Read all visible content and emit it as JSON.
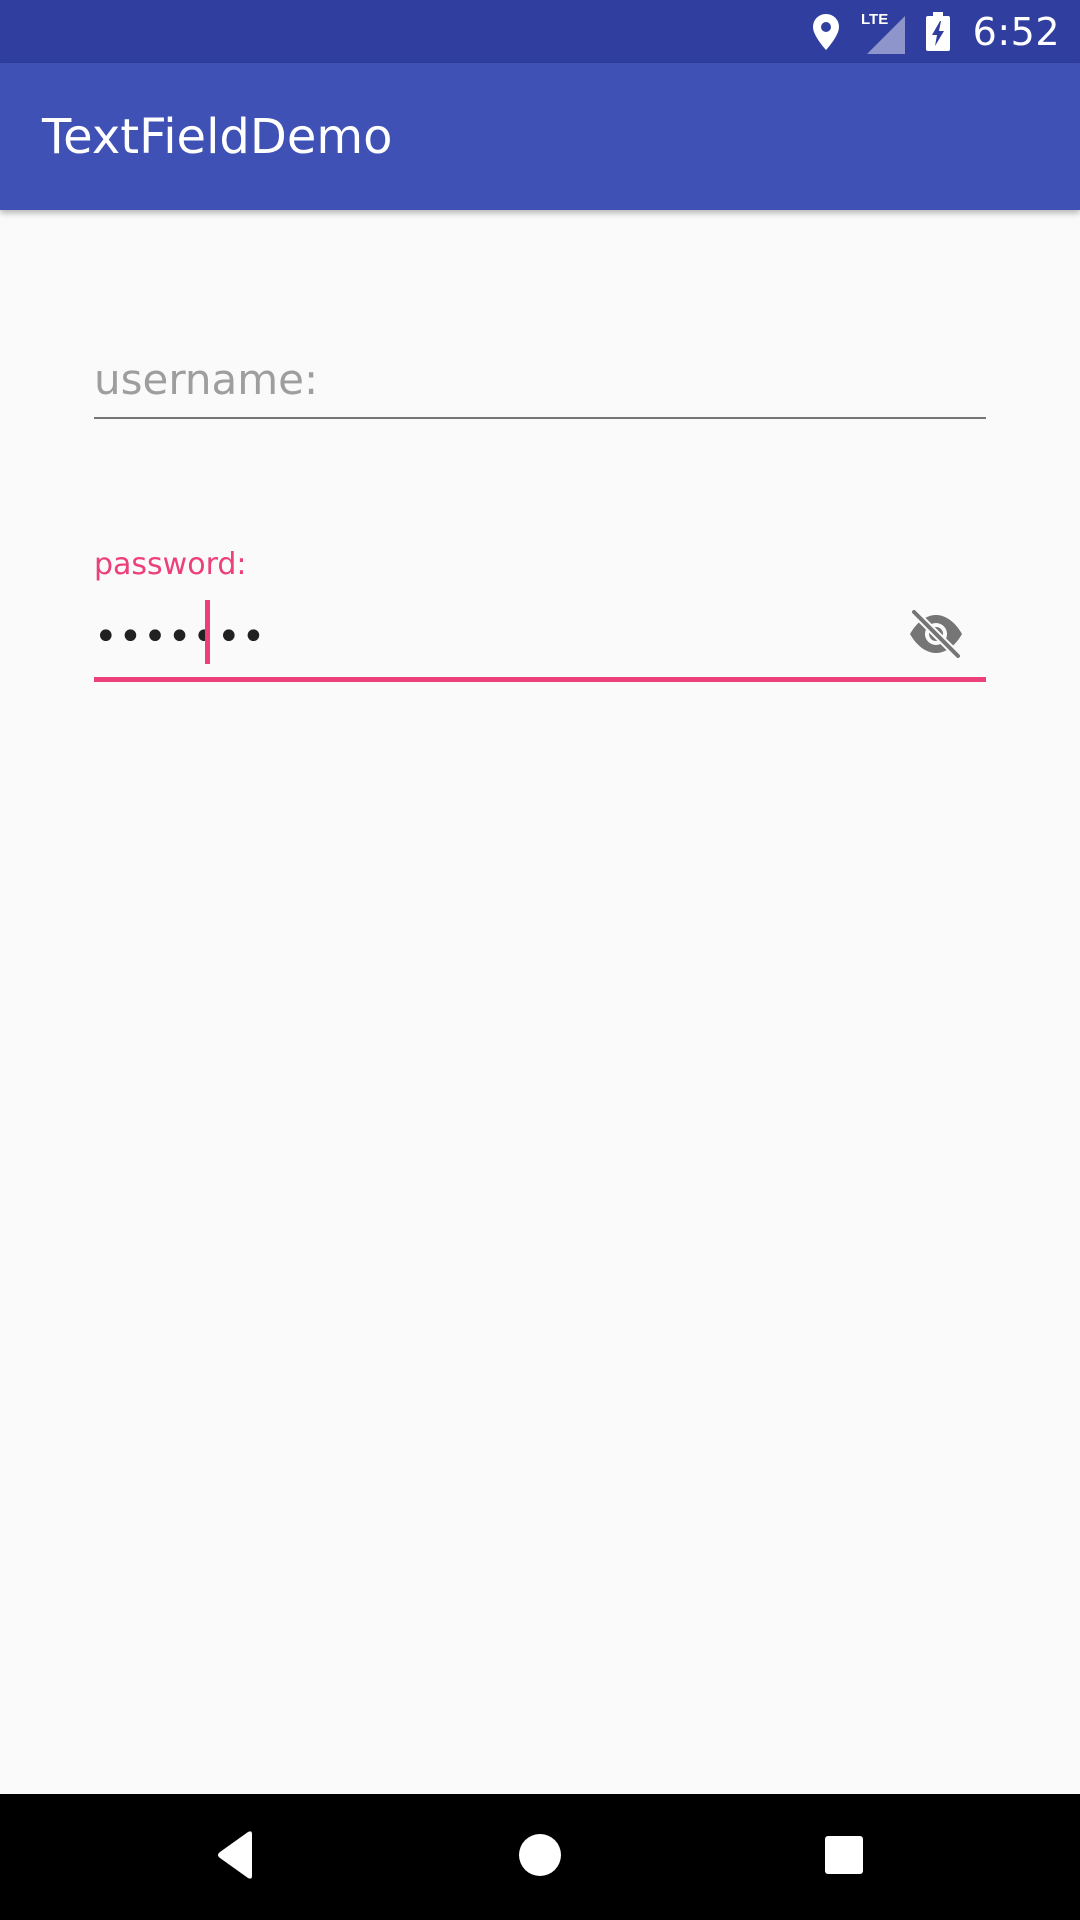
{
  "status_bar": {
    "time": "6:52",
    "network_label": "LTE",
    "icons": [
      "location-icon",
      "lte-signal-icon",
      "battery-charging-icon"
    ]
  },
  "app_bar": {
    "title": "TextFieldDemo"
  },
  "form": {
    "username": {
      "placeholder": "username:",
      "value": ""
    },
    "password": {
      "label": "password:",
      "value": "•••••••",
      "toggle_icon": "visibility-off-icon"
    }
  },
  "nav_bar": {
    "icons": [
      "back-icon",
      "home-icon",
      "recents-icon"
    ]
  },
  "colors": {
    "status_bar": "#303f9f",
    "app_bar": "#3f51b5",
    "accent": "#ec407a",
    "background": "#fafafa"
  }
}
